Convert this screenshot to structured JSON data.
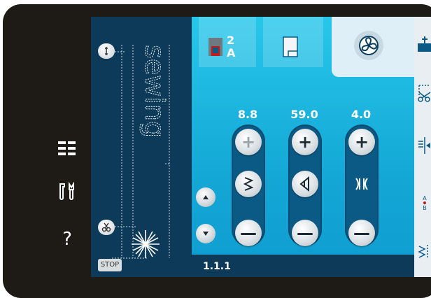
{
  "params": {
    "width_value": "8.8",
    "length_value": "59.0",
    "tension_value": "4.0"
  },
  "stitch": {
    "id": "1.1.1"
  },
  "top": {
    "needle_label": "2",
    "presser_label": "A"
  },
  "stop_label": "STOP",
  "help_label": "?",
  "sewout_text": "sewing",
  "colors": {
    "accent": "#1fb8e2",
    "dark_panel": "#0c3a58",
    "bezel": "#1e1a16"
  },
  "icons": [
    "menu-icon",
    "tools-icon",
    "help-icon",
    "needle-threader-icon",
    "scissors-icon",
    "stop-icon",
    "presser-foot-icon",
    "fan-stitch-icon",
    "tie-off-icon",
    "cut-thread-icon",
    "mirror-icon",
    "abc-icon",
    "zigzag-icon"
  ]
}
